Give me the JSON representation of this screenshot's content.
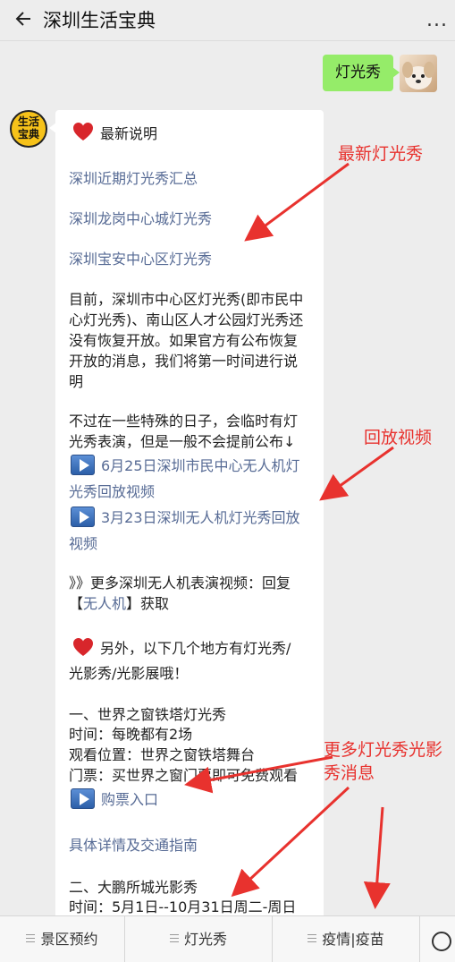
{
  "header": {
    "title": "深圳生活宝典",
    "more": "..."
  },
  "user_message": "灯光秀",
  "bot_avatar_text": "生活\n宝典",
  "message": {
    "latest_heading": "最新说明",
    "links": [
      "深圳近期灯光秀汇总",
      "深圳龙岗中心城灯光秀",
      "深圳宝安中心区灯光秀"
    ],
    "para1": [
      "目前，深圳市中心区灯光秀(即市民中",
      "心灯光秀)、南山区人才公园灯光秀还",
      "没有恢复开放。如果官方有公布恢复",
      "开放的消息，我们将第一时间进行说",
      "明"
    ],
    "para2": [
      "不过在一些特殊的日子，会临时有灯",
      "光秀表演，但是一般不会提前公布↓"
    ],
    "video1": [
      "6月25日深圳市民中心无人机灯",
      "光秀回放视频"
    ],
    "video2": [
      "3月23日深圳无人机灯光秀回放",
      "视频"
    ],
    "reply_line1": "》》更多深圳无人机表演视频：回复",
    "reply_open": "【",
    "reply_keyword": "无人机",
    "reply_close": "】获取",
    "other_places": [
      "另外，以下几个地方有灯光秀/",
      "光影秀/光影展哦！"
    ],
    "section1_title": "一、世界之窗铁塔灯光秀",
    "section1_time": "时间：每晚都有2场",
    "section1_location": "观看位置：世界之窗铁塔舞台",
    "section1_ticket": "门票：买世界之窗门票即可免费观看",
    "buy_ticket": "购票入口",
    "details_link": "具体详情及交通指南",
    "section2_title": "二、大鹏所城光影秀",
    "section2_time": "时间：5月1日--10月31日周二-周日"
  },
  "annotations": {
    "a1": "最新灯光秀",
    "a2": "回放视频",
    "a3": [
      "更多灯光秀光影",
      "秀消息"
    ]
  },
  "bottom_menu": [
    "景区预约",
    "灯光秀",
    "疫情|疫苗"
  ],
  "colors": {
    "link": "#576b95",
    "annotation": "#e8322e",
    "user_bubble": "#95ec69"
  }
}
